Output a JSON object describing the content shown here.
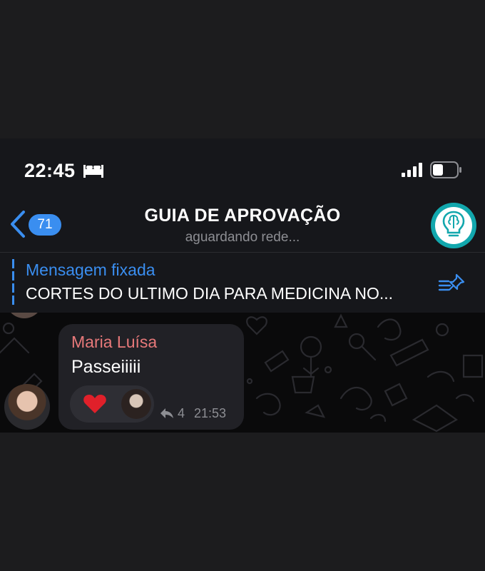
{
  "status_bar": {
    "time": "22:45",
    "icons": [
      "bed-icon",
      "signal-icon",
      "battery-icon"
    ]
  },
  "header": {
    "back_badge": "71",
    "title": "GUIA DE APROVAÇÃO",
    "subtitle": "aguardando rede...",
    "channel_avatar_icon": "lightbulb-brain-icon",
    "accent_color": "#3a8ef0"
  },
  "pinned": {
    "title": "Mensagem fixada",
    "text": "CORTES DO ULTIMO DIA PARA MEDICINA NO...",
    "icon": "pinned-list-icon"
  },
  "messages": [
    {
      "sender": "Maria Luísa",
      "sender_color": "#e8797a",
      "text": "Passeiiiii",
      "reaction": "heart-icon",
      "reply_count": "4",
      "time": "21:53"
    }
  ]
}
